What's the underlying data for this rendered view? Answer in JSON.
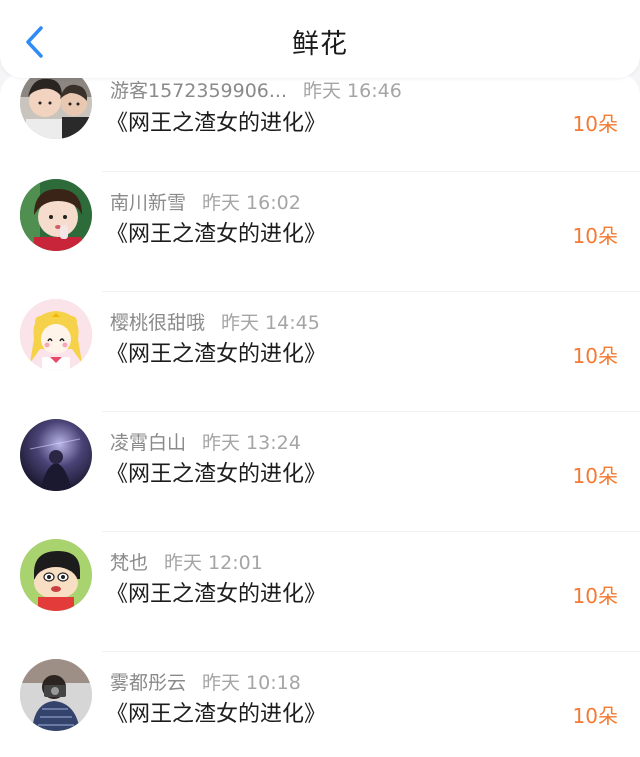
{
  "header": {
    "title": "鲜花",
    "back_icon": "chevron-left-icon",
    "accent_color": "#2f8bf5"
  },
  "flower_color": "#f37a33",
  "items": [
    {
      "user": "游客1572359906...",
      "time": "昨天 16:46",
      "book": "《网王之渣女的进化》",
      "flowers": "10朵",
      "avatar": "two-young-men-photo"
    },
    {
      "user": "南川新雪",
      "time": "昨天 16:02",
      "book": "《网王之渣女的进化》",
      "flowers": "10朵",
      "avatar": "girl-photo"
    },
    {
      "user": "樱桃很甜哦",
      "time": "昨天 14:45",
      "book": "《网王之渣女的进化》",
      "flowers": "10朵",
      "avatar": "sailor-moon-cartoon"
    },
    {
      "user": "凌霄白山",
      "time": "昨天 13:24",
      "book": "《网王之渣女的进化》",
      "flowers": "10朵",
      "avatar": "dark-night-sky-photo"
    },
    {
      "user": "梵也",
      "time": "昨天 12:01",
      "book": "《网王之渣女的进化》",
      "flowers": "10朵",
      "avatar": "crayon-shin-chan-cartoon"
    },
    {
      "user": "雾都彤云",
      "time": "昨天 10:18",
      "book": "《网王之渣女的进化》",
      "flowers": "10朵",
      "avatar": "person-with-camera-photo"
    }
  ]
}
